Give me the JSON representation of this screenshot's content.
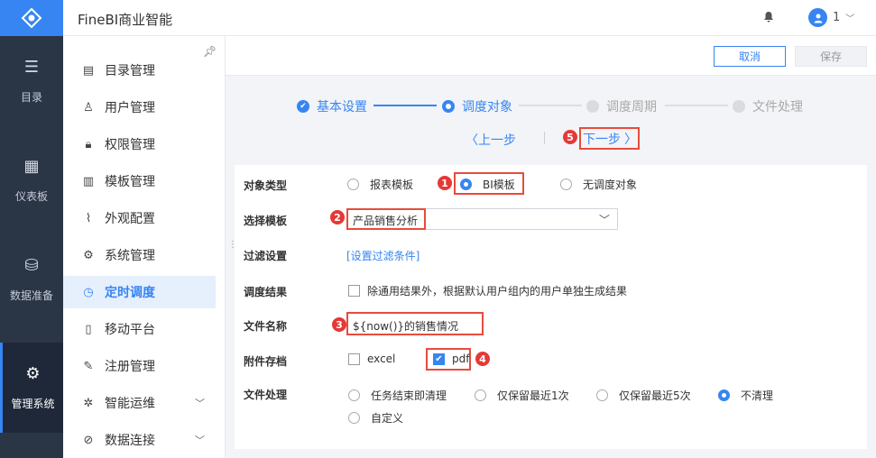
{
  "app": {
    "title": "FineBI商业智能",
    "user_name": "1"
  },
  "rail": [
    {
      "label": "目录",
      "icon": "list-icon"
    },
    {
      "label": "仪表板",
      "icon": "dashboard-icon"
    },
    {
      "label": "数据准备",
      "icon": "database-icon"
    },
    {
      "label": "管理系统",
      "icon": "gear-icon",
      "active": true
    }
  ],
  "menu": [
    {
      "label": "目录管理",
      "icon": "catalog-icon"
    },
    {
      "label": "用户管理",
      "icon": "user-icon"
    },
    {
      "label": "权限管理",
      "icon": "lock-icon"
    },
    {
      "label": "模板管理",
      "icon": "template-icon"
    },
    {
      "label": "外观配置",
      "icon": "brush-icon"
    },
    {
      "label": "系统管理",
      "icon": "settings-icon"
    },
    {
      "label": "定时调度",
      "icon": "clock-icon",
      "active": true
    },
    {
      "label": "移动平台",
      "icon": "mobile-icon"
    },
    {
      "label": "注册管理",
      "icon": "register-icon"
    },
    {
      "label": "智能运维",
      "icon": "ops-icon"
    },
    {
      "label": "数据连接",
      "icon": "link-icon"
    }
  ],
  "toolbar": {
    "cancel": "取消",
    "save": "保存"
  },
  "steps": [
    {
      "label": "基本设置",
      "state": "done"
    },
    {
      "label": "调度对象",
      "state": "current"
    },
    {
      "label": "调度周期",
      "state": "todo"
    },
    {
      "label": "文件处理",
      "state": "todo"
    }
  ],
  "nav": {
    "prev": "上一步",
    "next": "下一步"
  },
  "badges": [
    "1",
    "2",
    "3",
    "4",
    "5"
  ],
  "form": {
    "object_type": {
      "label": "对象类型",
      "options": [
        "报表模板",
        "BI模板",
        "无调度对象"
      ],
      "selected": "BI模板"
    },
    "template": {
      "label": "选择模板",
      "value": "产品销售分析"
    },
    "filter": {
      "label": "过滤设置",
      "link": "[设置过滤条件]"
    },
    "result": {
      "label": "调度结果",
      "option": "除通用结果外，根据默认用户组内的用户单独生成结果",
      "checked": false
    },
    "file_name": {
      "label": "文件名称",
      "value": "${now()}的销售情况"
    },
    "attachment": {
      "label": "附件存档",
      "options": [
        {
          "label": "excel",
          "checked": false
        },
        {
          "label": "pdf",
          "checked": true
        }
      ]
    },
    "file_handling": {
      "label": "文件处理",
      "options": [
        "任务结束即清理",
        "仅保留最近1次",
        "仅保留最近5次",
        "不清理",
        "自定义"
      ],
      "selected": "不清理"
    }
  },
  "colors": {
    "accent": "#3685f2",
    "rail_bg": "#2a3546",
    "highlight": "#e74c3c"
  }
}
